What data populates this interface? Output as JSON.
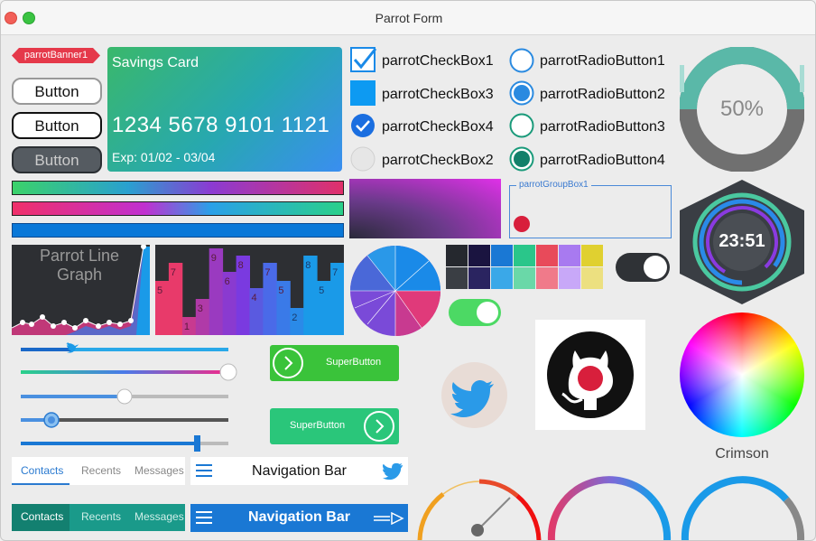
{
  "window": {
    "title": "Parrot Form"
  },
  "banner": {
    "label": "parrotBanner1"
  },
  "buttons": [
    {
      "label": "Button"
    },
    {
      "label": "Button"
    },
    {
      "label": "Button"
    }
  ],
  "card": {
    "title": "Savings Card",
    "number": "1234 5678 9101 1121",
    "expiry": "Exp: 01/02 - 03/04"
  },
  "checkboxes": [
    {
      "label": "parrotCheckBox1",
      "checked": true
    },
    {
      "label": "parrotCheckBox3",
      "checked": false
    },
    {
      "label": "parrotCheckBox4",
      "checked": true
    },
    {
      "label": "parrotCheckBox2",
      "checked": false
    }
  ],
  "radios": [
    {
      "label": "parrotRadioButton1",
      "checked": false
    },
    {
      "label": "parrotRadioButton2",
      "checked": true
    },
    {
      "label": "parrotRadioButton3",
      "checked": false
    },
    {
      "label": "parrotRadioButton4",
      "checked": true
    }
  ],
  "circle_progress": {
    "text": "50%",
    "value": 0.5
  },
  "groupbox": {
    "label": "parrotGroupBox1"
  },
  "clock": {
    "time": "23:51"
  },
  "line_graph": {
    "title_line1": "Parrot Line",
    "title_line2": "Graph"
  },
  "bar_graph_labels": [
    "5",
    "7",
    "1",
    "3",
    "9",
    "6",
    "8",
    "4",
    "7",
    "5",
    "2",
    "8",
    "5",
    "7"
  ],
  "super_buttons": [
    {
      "label": "SuperButton"
    },
    {
      "label": "SuperButton"
    }
  ],
  "color_picker": {
    "selected": "Crimson"
  },
  "tabs": {
    "items": [
      "Contacts",
      "Recents",
      "Messages"
    ]
  },
  "navbar": {
    "title": "Navigation Bar"
  },
  "sliders": [
    {
      "value": 0.24
    },
    {
      "value": 1.0
    },
    {
      "value": 0.5
    },
    {
      "value": 0.15
    },
    {
      "value": 0.85
    }
  ],
  "colors": {
    "accent_blue": "#1a78d4",
    "crimson": "#d81f3c",
    "green": "#3ac33a",
    "teal": "#1a9a8a"
  },
  "icons": [
    "checkmark-icon",
    "twitter-icon",
    "github-icon",
    "hamburger-icon",
    "arrow-right-icon",
    "double-arrow-icon"
  ]
}
